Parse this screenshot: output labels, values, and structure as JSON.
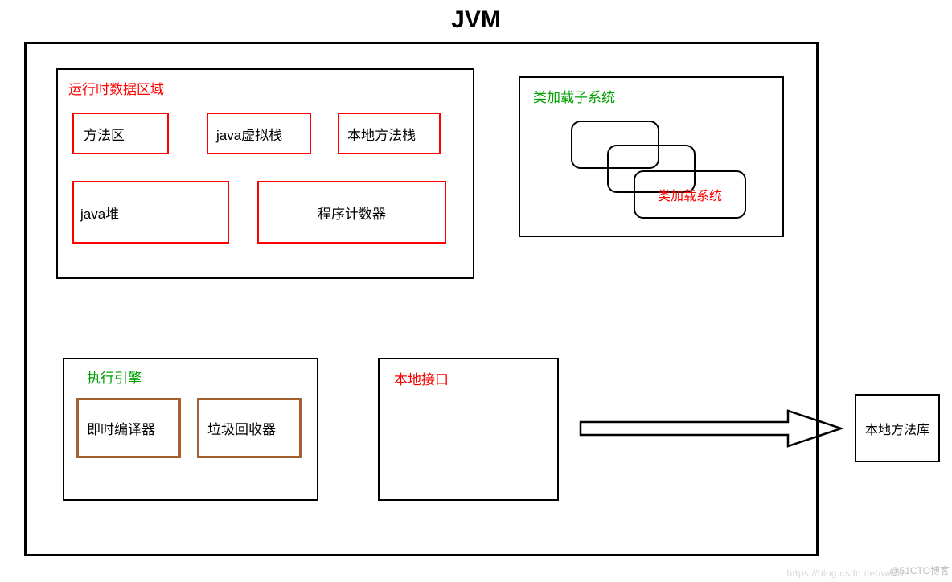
{
  "title": "JVM",
  "runtime": {
    "title": "运行时数据区域",
    "method_area": "方法区",
    "jvms": "java虚拟栈",
    "native_stack": "本地方法栈",
    "heap": "java堆",
    "pc": "程序计数器"
  },
  "loader": {
    "title": "类加载子系统",
    "inner": "类加载系统"
  },
  "exec": {
    "title": "执行引擎",
    "jit": "即时编译器",
    "gc": "垃圾回收器"
  },
  "native_if": {
    "title": "本地接口"
  },
  "native_lib": "本地方法库",
  "watermark1": "https://blog.csdn.net/weixi",
  "watermark2": "@51CTO博客"
}
